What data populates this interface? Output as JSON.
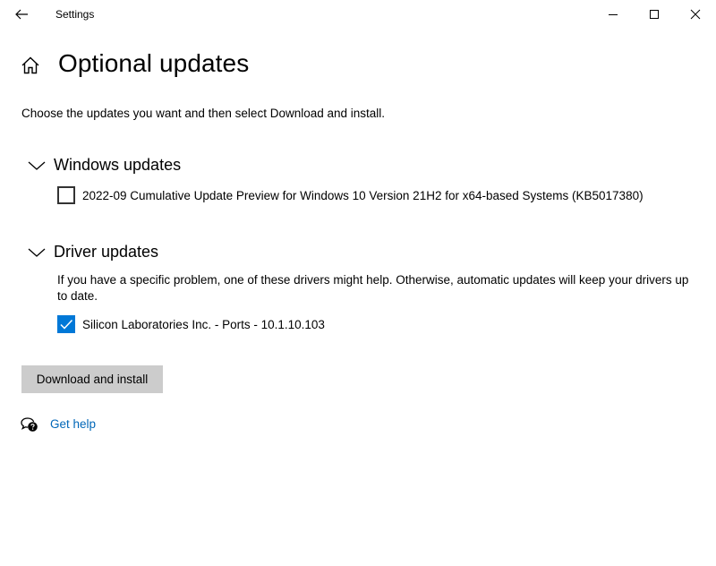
{
  "window": {
    "title": "Settings",
    "controls": {
      "back": "back-arrow-icon",
      "minimize": "minimize-icon",
      "maximize": "maximize-icon",
      "close": "close-icon"
    }
  },
  "page": {
    "home_icon": "home-icon",
    "title": "Optional updates",
    "intro": "Choose the updates you want and then select Download and install."
  },
  "sections": {
    "windows_updates": {
      "title": "Windows updates",
      "expanded": true,
      "items": [
        {
          "label": "2022-09 Cumulative Update Preview for Windows 10 Version 21H2 for x64-based Systems (KB5017380)",
          "checked": false
        }
      ]
    },
    "driver_updates": {
      "title": "Driver updates",
      "expanded": true,
      "description": "If you have a specific problem, one of these drivers might help. Otherwise, automatic updates will keep your drivers up to date.",
      "items": [
        {
          "label": "Silicon Laboratories Inc. - Ports - 10.1.10.103",
          "checked": true
        }
      ]
    }
  },
  "actions": {
    "download_label": "Download and install"
  },
  "help": {
    "icon": "help-chat-icon",
    "label": "Get help"
  },
  "colors": {
    "accent": "#0078d7",
    "link": "#0067b8",
    "button_bg": "#cccccc"
  }
}
